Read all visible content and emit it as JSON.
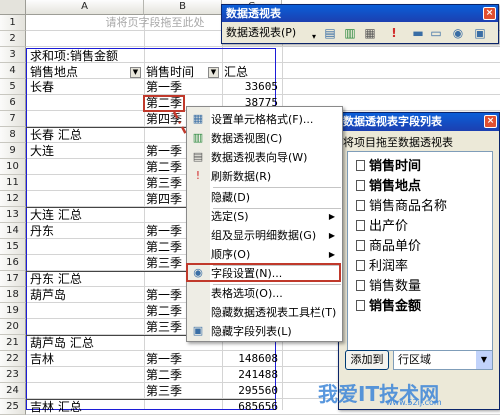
{
  "columns": [
    "A",
    "B",
    "C"
  ],
  "rows": [
    "1",
    "2",
    "3",
    "4",
    "5",
    "6",
    "7",
    "8",
    "9",
    "10",
    "11",
    "12",
    "13",
    "14",
    "15",
    "16",
    "17",
    "18",
    "19",
    "20",
    "21",
    "22",
    "23",
    "24",
    "25"
  ],
  "sheet": {
    "drop_hint": "请将页字段拖至此处",
    "pivot_title": "求和项:销售金额",
    "header_place": "销售地点",
    "header_time": "销售时间",
    "header_total": "汇总",
    "cells": [
      {
        "row": 5,
        "a": "长春",
        "b": "第一季",
        "c": "33605"
      },
      {
        "row": 6,
        "a": "",
        "b": "第二季",
        "c": "38775"
      },
      {
        "row": 7,
        "a": "",
        "b": "第四季",
        "c": ""
      },
      {
        "row": 8,
        "a": "长春 汇总",
        "b": "",
        "c": ""
      },
      {
        "row": 9,
        "a": "大连",
        "b": "第一季",
        "c": ""
      },
      {
        "row": 10,
        "a": "",
        "b": "第二季",
        "c": ""
      },
      {
        "row": 11,
        "a": "",
        "b": "第三季",
        "c": ""
      },
      {
        "row": 12,
        "a": "",
        "b": "第四季",
        "c": ""
      },
      {
        "row": 13,
        "a": "大连 汇总",
        "b": "",
        "c": ""
      },
      {
        "row": 14,
        "a": "丹东",
        "b": "第一季",
        "c": ""
      },
      {
        "row": 15,
        "a": "",
        "b": "第二季",
        "c": ""
      },
      {
        "row": 16,
        "a": "",
        "b": "第三季",
        "c": ""
      },
      {
        "row": 17,
        "a": "丹东 汇总",
        "b": "",
        "c": ""
      },
      {
        "row": 18,
        "a": "葫芦岛",
        "b": "第一季",
        "c": ""
      },
      {
        "row": 19,
        "a": "",
        "b": "第二季",
        "c": ""
      },
      {
        "row": 20,
        "a": "",
        "b": "第三季",
        "c": ""
      },
      {
        "row": 21,
        "a": "葫芦岛 汇总",
        "b": "",
        "c": ""
      },
      {
        "row": 22,
        "a": "吉林",
        "b": "第一季",
        "c": "148608"
      },
      {
        "row": 23,
        "a": "",
        "b": "第二季",
        "c": "241488"
      },
      {
        "row": 24,
        "a": "",
        "b": "第三季",
        "c": "295560"
      },
      {
        "row": 25,
        "a": "吉林 汇总",
        "b": "",
        "c": "685656"
      }
    ]
  },
  "toolbar": {
    "title": "数据透视表",
    "menu_label": "数据透视表(P)",
    "close": "×",
    "icons": [
      "format-report-icon",
      "chart-wizard-icon",
      "pivot-wizard-icon",
      "refresh-icon",
      "hide-detail-icon",
      "show-detail-icon",
      "field-settings-icon",
      "field-list-icon"
    ]
  },
  "context_menu": {
    "items": [
      {
        "label": "设置单元格格式(F)...",
        "icon": "format-cells-icon",
        "submenu": false
      },
      {
        "label": "数据透视图(C)",
        "icon": "pivot-chart-icon",
        "submenu": false
      },
      {
        "label": "数据透视表向导(W)",
        "icon": "pivot-wizard-icon",
        "submenu": false
      },
      {
        "label": "刷新数据(R)",
        "icon": "refresh-icon",
        "submenu": false
      },
      {
        "label": "隐藏(D)",
        "icon": "",
        "submenu": false
      },
      {
        "label": "选定(S)",
        "icon": "",
        "submenu": true
      },
      {
        "label": "组及显示明细数据(G)",
        "icon": "",
        "submenu": true
      },
      {
        "label": "顺序(O)",
        "icon": "",
        "submenu": true
      },
      {
        "label": "字段设置(N)...",
        "icon": "field-settings-icon",
        "submenu": false
      },
      {
        "label": "表格选项(O)...",
        "icon": "",
        "submenu": false
      },
      {
        "label": "隐藏数据透视表工具栏(T)",
        "icon": "",
        "submenu": false
      },
      {
        "label": "隐藏字段列表(L)",
        "icon": "field-list-icon",
        "submenu": false
      }
    ]
  },
  "field_list": {
    "title": "数据透视表字段列表",
    "instruction": "将项目拖至数据透视表",
    "fields": [
      {
        "label": "销售时间",
        "bold": true
      },
      {
        "label": "销售地点",
        "bold": true
      },
      {
        "label": "销售商品名称",
        "bold": false
      },
      {
        "label": "出产价",
        "bold": false
      },
      {
        "label": "商品单价",
        "bold": false
      },
      {
        "label": "利润率",
        "bold": false
      },
      {
        "label": "销售数量",
        "bold": false
      },
      {
        "label": "销售金额",
        "bold": true
      }
    ],
    "add_button": "添加到",
    "area_value": "行区域",
    "close": "×"
  },
  "watermark": {
    "text": "我爱IT技术网",
    "sub": "www.52ij.com"
  }
}
